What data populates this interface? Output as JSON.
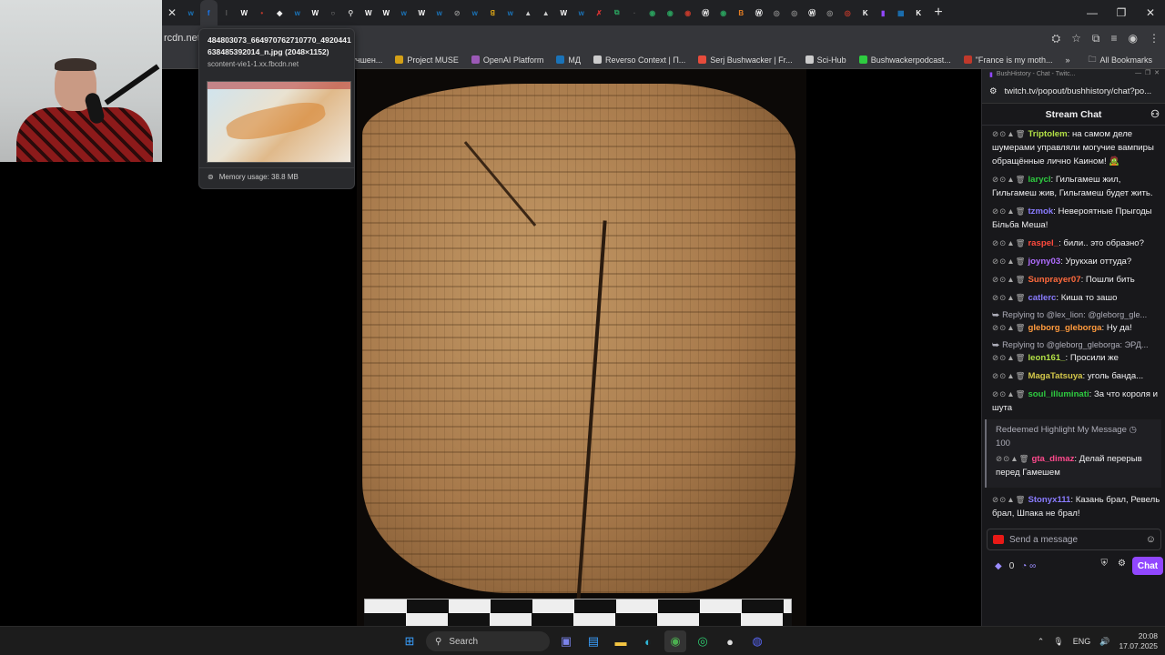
{
  "browser": {
    "url_fragment": "rcdn.net/",
    "tab_icons": [
      {
        "name": "w-tab-icon",
        "color": "#1a73b8",
        "glyph": "w"
      },
      {
        "name": "facebook-tab-icon",
        "color": "#1877f2",
        "glyph": "f"
      },
      {
        "name": "i-tab-icon",
        "color": "#555",
        "glyph": "I"
      },
      {
        "name": "w-tab-icon",
        "color": "#fff",
        "glyph": "W"
      },
      {
        "name": "red-tab-icon",
        "color": "#c0392b",
        "glyph": "•"
      },
      {
        "name": "tab-icon",
        "color": "#eee",
        "glyph": "◆"
      },
      {
        "name": "w-tab-icon",
        "color": "#1a73b8",
        "glyph": "w"
      },
      {
        "name": "w-tab-icon",
        "color": "#fff",
        "glyph": "W"
      },
      {
        "name": "tab-icon",
        "color": "#888",
        "glyph": "○"
      },
      {
        "name": "tab-icon",
        "color": "#ccc",
        "glyph": "⚲"
      },
      {
        "name": "w-tab-icon",
        "color": "#fff",
        "glyph": "W"
      },
      {
        "name": "w-tab-icon",
        "color": "#fff",
        "glyph": "W"
      },
      {
        "name": "w-tab-icon",
        "color": "#1a73b8",
        "glyph": "w"
      },
      {
        "name": "w-tab-icon",
        "color": "#fff",
        "glyph": "W"
      },
      {
        "name": "w-tab-icon",
        "color": "#1a73b8",
        "glyph": "w"
      },
      {
        "name": "tab-icon",
        "color": "#888",
        "glyph": "⊘"
      },
      {
        "name": "w-tab-icon",
        "color": "#1a73b8",
        "glyph": "w"
      },
      {
        "name": "tab-icon",
        "color": "#d4a017",
        "glyph": "ꓭ"
      },
      {
        "name": "w-tab-icon",
        "color": "#1a73b8",
        "glyph": "w"
      },
      {
        "name": "tab-icon",
        "color": "#ccc",
        "glyph": "▲"
      },
      {
        "name": "tab-icon",
        "color": "#ccc",
        "glyph": "▲"
      },
      {
        "name": "w-tab-icon",
        "color": "#fff",
        "glyph": "W"
      },
      {
        "name": "w-tab-icon",
        "color": "#1a73b8",
        "glyph": "w"
      },
      {
        "name": "tab-icon",
        "color": "#d33",
        "glyph": "✗"
      },
      {
        "name": "tab-icon",
        "color": "#2a9d5c",
        "glyph": "⧉"
      },
      {
        "name": "tab-icon",
        "color": "#555",
        "glyph": "·"
      },
      {
        "name": "tab-icon",
        "color": "#2a9d5c",
        "glyph": "◉"
      },
      {
        "name": "tab-icon",
        "color": "#2a9d5c",
        "glyph": "◉"
      },
      {
        "name": "tab-icon",
        "color": "#c0392b",
        "glyph": "◉"
      },
      {
        "name": "tab-icon",
        "color": "#fff",
        "glyph": "Ⓦ"
      },
      {
        "name": "tab-icon",
        "color": "#2a9d5c",
        "glyph": "◉"
      },
      {
        "name": "tab-icon",
        "color": "#e67e22",
        "glyph": "B"
      },
      {
        "name": "tab-icon",
        "color": "#fff",
        "glyph": "Ⓦ"
      },
      {
        "name": "tab-icon",
        "color": "#888",
        "glyph": "◎"
      },
      {
        "name": "tab-icon",
        "color": "#888",
        "glyph": "◎"
      },
      {
        "name": "tab-icon",
        "color": "#fff",
        "glyph": "Ⓦ"
      },
      {
        "name": "tab-icon",
        "color": "#888",
        "glyph": "◎"
      },
      {
        "name": "tab-icon",
        "color": "#c0392b",
        "glyph": "◎"
      },
      {
        "name": "tab-icon",
        "color": "#fff",
        "glyph": "K"
      },
      {
        "name": "tab-icon",
        "color": "#9147ff",
        "glyph": "▮"
      },
      {
        "name": "tab-icon",
        "color": "#1a73b8",
        "glyph": "▦"
      },
      {
        "name": "tab-icon",
        "color": "#fff",
        "glyph": "K"
      }
    ],
    "bookmarks": [
      {
        "label": "ProQuest | Улучшен...",
        "color": "#555"
      },
      {
        "label": "Project MUSE",
        "color": "#d4a017"
      },
      {
        "label": "OpenAI Platform",
        "color": "#9b59b6"
      },
      {
        "label": "МД",
        "color": "#1a73b8"
      },
      {
        "label": "Reverso Context | П...",
        "color": "#ccc"
      },
      {
        "label": "Serj Bushwacker | Fr...",
        "color": "#e74c3c"
      },
      {
        "label": "Sci-Hub",
        "color": "#ccc"
      },
      {
        "label": "Bushwackerpodcast...",
        "color": "#2ecc40"
      },
      {
        "label": "\"France is my moth...",
        "color": "#c0392b"
      }
    ],
    "all_bookmarks": "All Bookmarks"
  },
  "tooltip": {
    "title": "484803073_664970762710770_4920441638485392014_n.jpg (2048×1152)",
    "domain": "scontent-vie1-1.xx.fbcdn.net",
    "memory": "Memory usage: 38.8 MB"
  },
  "chat_window": {
    "title": "BushHistory - Chat - Twitc...",
    "url": "twitch.tv/popout/bushhistory/chat?po...",
    "header": "Stream Chat",
    "messages": [
      {
        "user": "Triptolem",
        "color": "#b3e046",
        "text": ": на самом деле шумерами управляли могучие вампиры обращённые лично Каином! 🧟"
      },
      {
        "user": "larycl",
        "color": "#2ecc40",
        "text": ": Гильгамеш жил, Гильгамеш жив, Гильгамеш будет жить."
      },
      {
        "user": "tzmok",
        "color": "#8a7cff",
        "text": ": Невероятные Прыгоды Бiльба Меша!"
      },
      {
        "user": "raspel_",
        "color": "#ff4a3d",
        "text": ": били.. это образно?"
      },
      {
        "user": "joyny03",
        "color": "#b06dff",
        "text": ": Урукхаи оттуда?"
      },
      {
        "user": "Sunprayer07",
        "color": "#ff6a3d",
        "text": ": Пошли бить"
      },
      {
        "user": "catlerc",
        "color": "#8a7cff",
        "text": ": Киша то зашо"
      }
    ],
    "reply1": "Replying to @lex_lion: @gleborg_gle...",
    "msg_gleborg": {
      "user": "gleborg_gleborga",
      "color": "#ff9a3d",
      "text": ": Ну да!"
    },
    "reply2": "Replying to @gleborg_gleborga: ЭРД...",
    "messages2": [
      {
        "user": "leon161_",
        "color": "#b3e046",
        "text": ": Просили же"
      },
      {
        "user": "MagaTatsuya",
        "color": "#d4c84a",
        "text": ": уголь банда..."
      },
      {
        "user": "soul_illuminati",
        "color": "#2ecc40",
        "text": ": За что короля и шута"
      }
    ],
    "redeem_title": "Redeemed Highlight My Message",
    "redeem_cost": "100",
    "msg_gta": {
      "user": "gta_dimaz",
      "color": "#ff4a8d",
      "text": ": Делай перерыв перед Гамешем"
    },
    "msg_last": {
      "user": "Stonyx111",
      "color": "#8a7cff",
      "text": ": Казань брал, Ревель брал, Шпака не брал!"
    },
    "input_placeholder": "Send a message",
    "points": "0",
    "chat_button": "Chat"
  },
  "taskbar": {
    "search_label": "Search",
    "lang": "ENG",
    "time": "20:08",
    "date": "17.07.2025"
  }
}
